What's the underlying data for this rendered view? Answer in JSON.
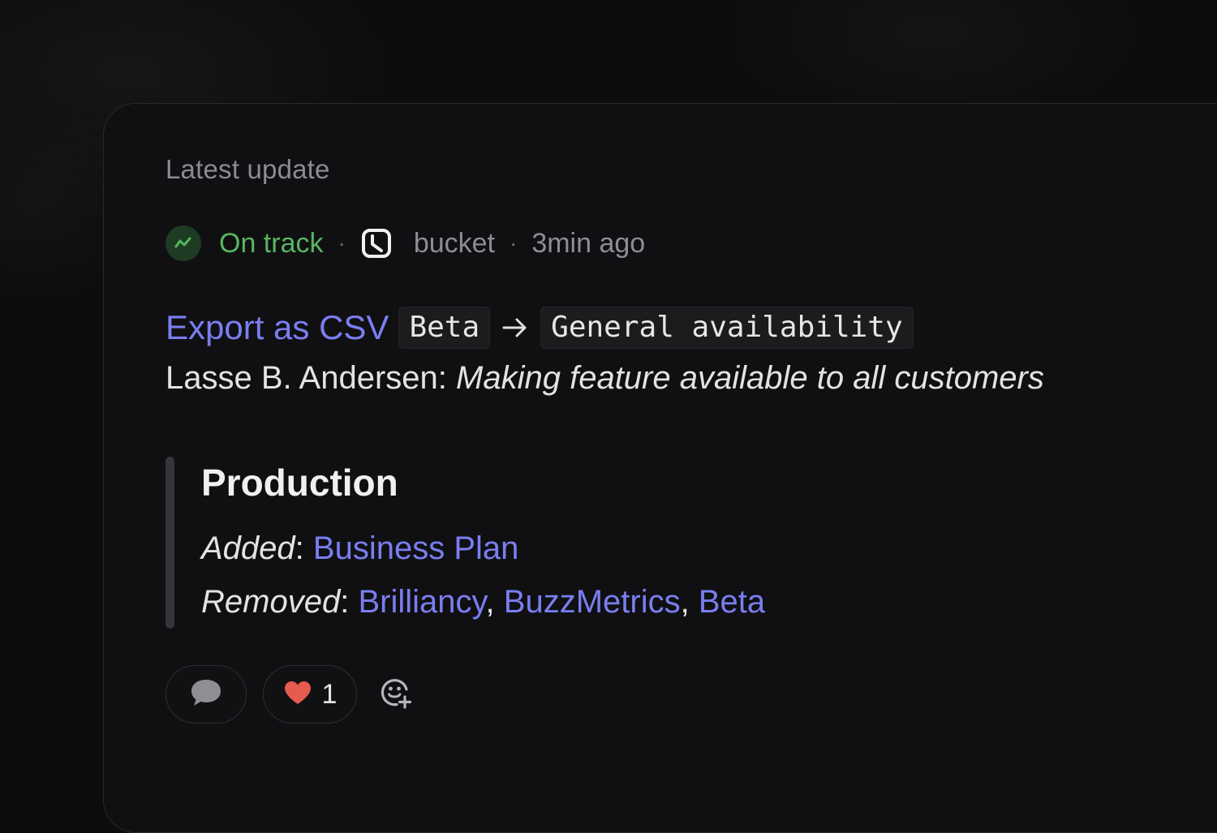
{
  "section_label": "Latest update",
  "meta": {
    "status": "On track",
    "separator": "·",
    "app_name": "bucket",
    "time": "3min ago"
  },
  "update": {
    "feature": "Export as CSV",
    "from_stage": "Beta",
    "to_stage": "General availability",
    "author_prefix": "Lasse B. Andersen:",
    "message": "Making feature available to all customers"
  },
  "environment": {
    "title": "Production",
    "added_label": "Added",
    "colon": ":",
    "comma": ",",
    "added_items": [
      "Business Plan"
    ],
    "removed_label": "Removed",
    "removed_items": [
      "Brilliancy",
      "BuzzMetrics",
      "Beta"
    ]
  },
  "reactions": {
    "heart_count": "1"
  },
  "colors": {
    "accent_link": "#7a7ef0",
    "status_green": "#57b561",
    "muted_text": "#8d8d93",
    "card_bg": "#101012"
  },
  "icons": [
    "status-trend-icon",
    "bucket-app-icon",
    "arrow-right-icon",
    "comment-icon",
    "heart-icon",
    "add-reaction-icon"
  ]
}
